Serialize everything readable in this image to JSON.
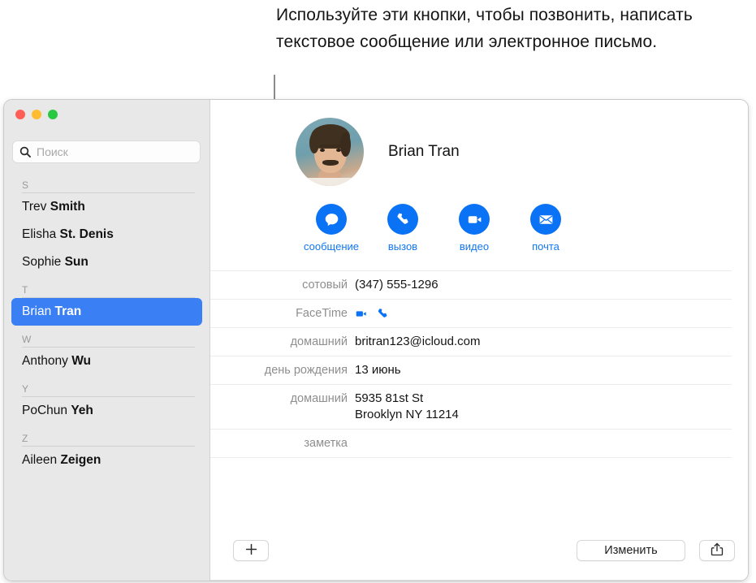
{
  "callout": {
    "text": "Используйте эти кнопки, чтобы позвонить, написать текстовое сообщение или электронное письмо."
  },
  "window": {
    "traffic_lights": {
      "close_color": "#ff5f57",
      "minimize_color": "#febc2e",
      "zoom_color": "#28c840"
    }
  },
  "sidebar": {
    "search": {
      "placeholder": "Поиск",
      "value": "",
      "icon": "search-icon"
    },
    "groups": [
      {
        "letter": "S",
        "contacts": [
          {
            "first": "Trev ",
            "last": "Smith",
            "selected": false
          },
          {
            "first": "Elisha ",
            "last": "St. Denis",
            "selected": false
          },
          {
            "first": "Sophie ",
            "last": "Sun",
            "selected": false
          }
        ]
      },
      {
        "letter": "T",
        "contacts": [
          {
            "first": "Brian ",
            "last": "Tran",
            "selected": true
          }
        ]
      },
      {
        "letter": "W",
        "contacts": [
          {
            "first": "Anthony ",
            "last": "Wu",
            "selected": false
          }
        ]
      },
      {
        "letter": "Y",
        "contacts": [
          {
            "first": "PoChun ",
            "last": "Yeh",
            "selected": false
          }
        ]
      },
      {
        "letter": "Z",
        "contacts": [
          {
            "first": "Aileen ",
            "last": "Zeigen",
            "selected": false
          }
        ]
      }
    ]
  },
  "detail": {
    "contact_name": "Brian Tran",
    "avatar_alt": "Brian Tran",
    "accent_color": "#0a72f5",
    "label_color": "#1277f1",
    "action_buttons": [
      {
        "label": "сообщение",
        "icon": "message-icon"
      },
      {
        "label": "вызов",
        "icon": "phone-icon"
      },
      {
        "label": "видео",
        "icon": "video-icon"
      },
      {
        "label": "почта",
        "icon": "mail-icon"
      }
    ],
    "fields": [
      {
        "label": "сотовый",
        "value": "(347) 555-1296",
        "type": "text"
      },
      {
        "label": "FaceTime",
        "value": "",
        "type": "icons",
        "icons": [
          "facetime-video-icon",
          "facetime-audio-icon"
        ]
      },
      {
        "label": "домашний",
        "value": "britran123@icloud.com",
        "type": "text"
      },
      {
        "label": "день рождения",
        "value": "13 июнь",
        "type": "text"
      },
      {
        "label": "домашний",
        "value": "5935 81st St\nBrooklyn NY 11214",
        "type": "multiline"
      },
      {
        "label": "заметка",
        "value": "",
        "type": "text"
      }
    ],
    "toolbar": {
      "add_label": "+",
      "add_icon": "plus-icon",
      "edit_label": "Изменить",
      "share_icon": "share-icon"
    }
  }
}
